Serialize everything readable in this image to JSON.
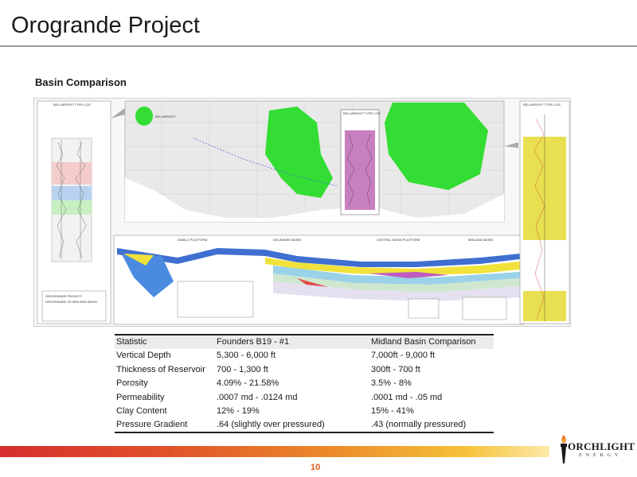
{
  "slide": {
    "title": "Orogrande Project",
    "section_heading": "Basin Comparison",
    "page_number": "10"
  },
  "figure": {
    "left_log_label": "BELLWRIGHT TYPE LOG",
    "left_caption_1": "OROGRANDE PROJECT",
    "left_caption_2": "OROGRANDE VS MIDLAND BASIN",
    "center_log_label": "BELLWRIGHT TYPE LOG",
    "right_log_label": "BELLWRIGHT TYPE LOG",
    "map_label_left": "BELLWRIGHT",
    "section_labels": [
      "DIABLO PLATFORM",
      "DELAWARE BASIN",
      "CENTRAL BASIN PLATFORM",
      "MIDLAND BASIN"
    ]
  },
  "table": {
    "headers": [
      "Statistic",
      "Founders B19 - #1",
      "Midland Basin Comparison"
    ],
    "rows": [
      [
        "Vertical Depth",
        "5,300 - 6,000 ft",
        "7,000ft - 9,000 ft"
      ],
      [
        "Thickness of Reservoir",
        "700 - 1,300 ft",
        "300ft - 700 ft"
      ],
      [
        "Porosity",
        "4.09% - 21.58%",
        "3.5% - 8%"
      ],
      [
        "Permeability",
        ".0007 md - .0124 md",
        ".0001 md - .05 md"
      ],
      [
        "Clay Content",
        "12% - 19%",
        "15% - 41%"
      ],
      [
        "Pressure Gradient",
        ".64 (slightly over pressured)",
        ".43 (normally pressured)"
      ]
    ]
  },
  "logo": {
    "name": "ORCHLIGHT",
    "sub": "ENERGY",
    "icon": "torch-icon"
  },
  "colors": {
    "page_number": "#e2581e",
    "band_start": "#d62e2e",
    "band_end": "#fde9a8",
    "map_highlight": "#33dd33",
    "log_highlight": "#e8e050"
  }
}
